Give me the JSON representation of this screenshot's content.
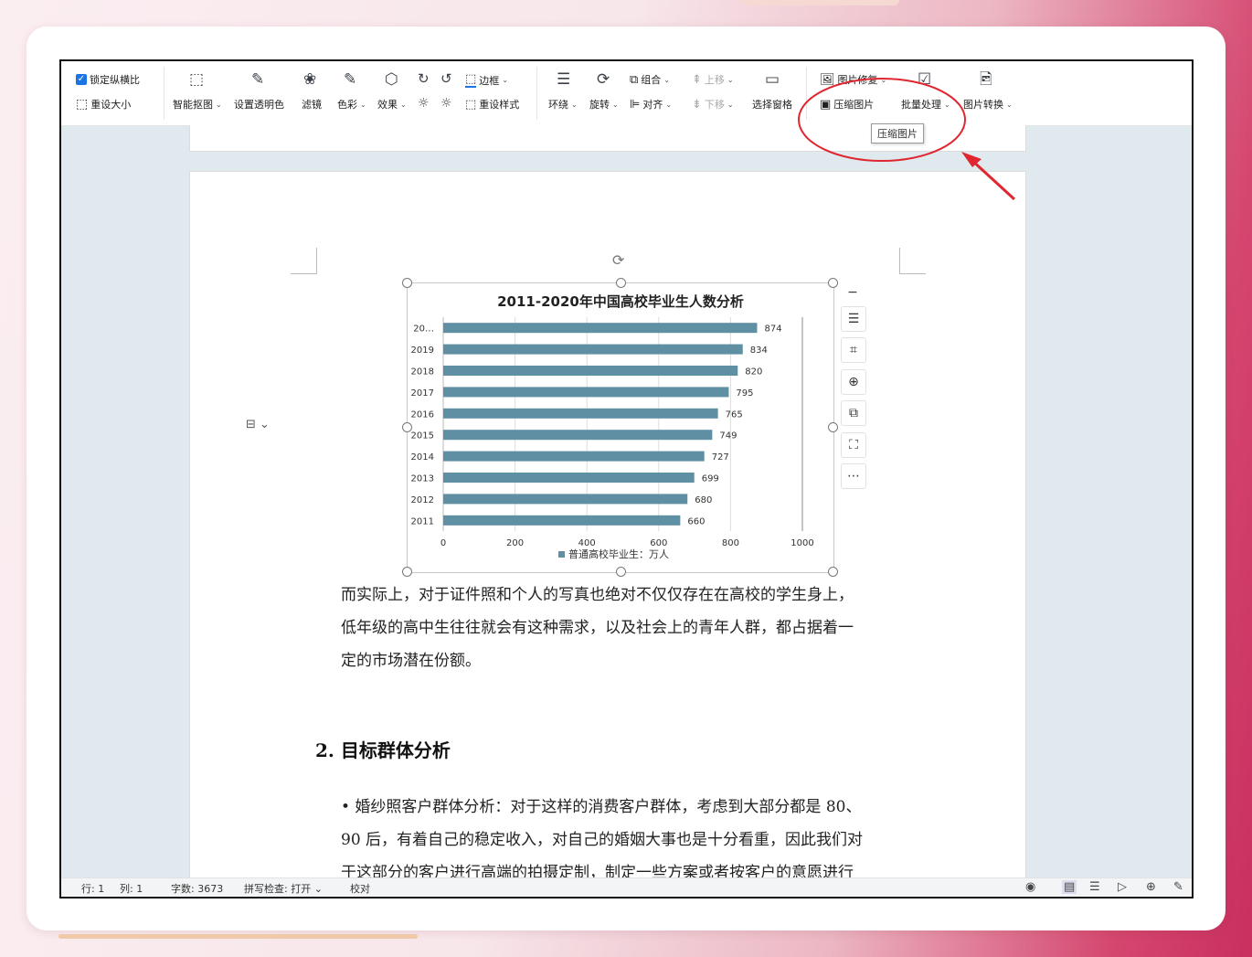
{
  "ribbon": {
    "lock_ratio": "锁定纵横比",
    "reset_size": "重设大小",
    "smart_cutout": "智能抠图",
    "set_transparent": "设置透明色",
    "filter": "滤镜",
    "color": "色彩",
    "effect": "效果",
    "border": "边框",
    "reset_style": "重设样式",
    "wrap": "环绕",
    "rotate": "旋转",
    "group": "组合",
    "align": "对齐",
    "move_up": "上移",
    "move_down": "下移",
    "selection_pane": "选择窗格",
    "image_repair": "图片修复",
    "compress_image": "压缩图片",
    "batch_process": "批量处理",
    "image_convert": "图片转换"
  },
  "tooltip": "压缩图片",
  "chart_data": {
    "type": "bar",
    "title": "2011-2020年中国高校毕业生人数分析",
    "categories": [
      "20…",
      "2019",
      "2018",
      "2017",
      "2016",
      "2015",
      "2014",
      "2013",
      "2012",
      "2011"
    ],
    "series": [
      {
        "name": "普通高校毕业生：万人",
        "values": [
          874,
          834,
          820,
          795,
          765,
          749,
          727,
          699,
          680,
          660
        ]
      }
    ],
    "xticks": [
      "0",
      "200",
      "400",
      "600",
      "800",
      "1000"
    ],
    "xlim": [
      0,
      1000
    ],
    "legend": "bottom",
    "grid": true,
    "bar_color": "#5f8fa3"
  },
  "body": {
    "para1_line1": "而实际上，对于证件照和个人的写真也绝对不仅仅存在在高校的学生身上，",
    "para1_line2": "低年级的高中生往往就会有这种需求，以及社会上的青年人群，都占据着一",
    "para1_line3": "定的市场潜在份额。",
    "heading": "2. 目标群体分析",
    "para2_line1": "• 婚纱照客户群体分析：对于这样的消费客户群体，考虑到大部分都是 80、",
    "para2_line2": "90 后，有着自己的稳定收入，对自己的婚姻大事也是十分看重，因此我们对",
    "para2_line3": "于这部分的客户进行高端的拍摄定制，制定一些方案或者按客户的意愿进行"
  },
  "status": {
    "row": "行: 1",
    "col": "列: 1",
    "word_count": "字数: 3673",
    "spell_check": "拼写检查: 打开",
    "proof": "校对"
  },
  "colors": {
    "annotation": "#e0262f",
    "accent": "#1b74e4"
  }
}
